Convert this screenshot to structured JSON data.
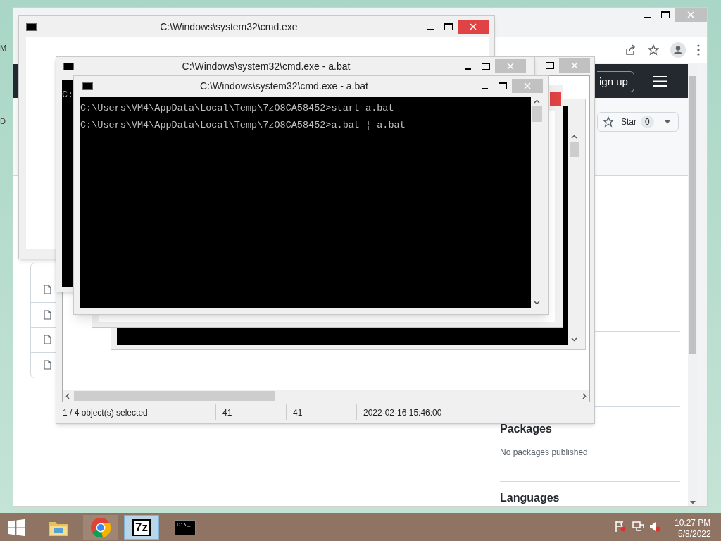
{
  "desktop": {
    "icon_labels": [
      "M",
      "D"
    ]
  },
  "browser": {
    "page": {
      "signup": "ign up",
      "star": {
        "label": "Star",
        "count": "0"
      },
      "sections": [
        {
          "heading": "Packages",
          "text": "No packages published"
        },
        {
          "heading": "Languages"
        }
      ]
    }
  },
  "back_console": {
    "title": "C:\\Windows\\system32\\cmd.exe",
    "close_hover": true
  },
  "archive_window": {
    "status": [
      "1 / 4 object(s) selected",
      "41",
      "41",
      "2022-02-16 15:46:00"
    ]
  },
  "middle_console": {
    "title": "C:\\Windows\\system32\\cmd.exe - a.bat",
    "close_hover": false,
    "lines": [
      "C:"
    ]
  },
  "front_console": {
    "title": "C:\\Windows\\system32\\cmd.exe - a.bat",
    "close_hover": false,
    "lines": [
      "C:\\Users\\VM4\\AppData\\Local\\Temp\\7zO8CA58452>start a.bat",
      "C:\\Users\\VM4\\AppData\\Local\\Temp\\7zO8CA58452>a.bat ¦ a.bat"
    ]
  },
  "taskbar": {
    "apps": [
      {
        "kind": "start",
        "selected": false
      },
      {
        "kind": "explorer",
        "selected": false
      },
      {
        "kind": "chrome",
        "selected": false
      },
      {
        "kind": "archiver",
        "selected": true,
        "label": "7z"
      },
      {
        "kind": "console",
        "selected": false,
        "label": "C:\\_"
      }
    ],
    "clock": {
      "time": "10:27 PM",
      "date": "5/8/2022"
    }
  }
}
